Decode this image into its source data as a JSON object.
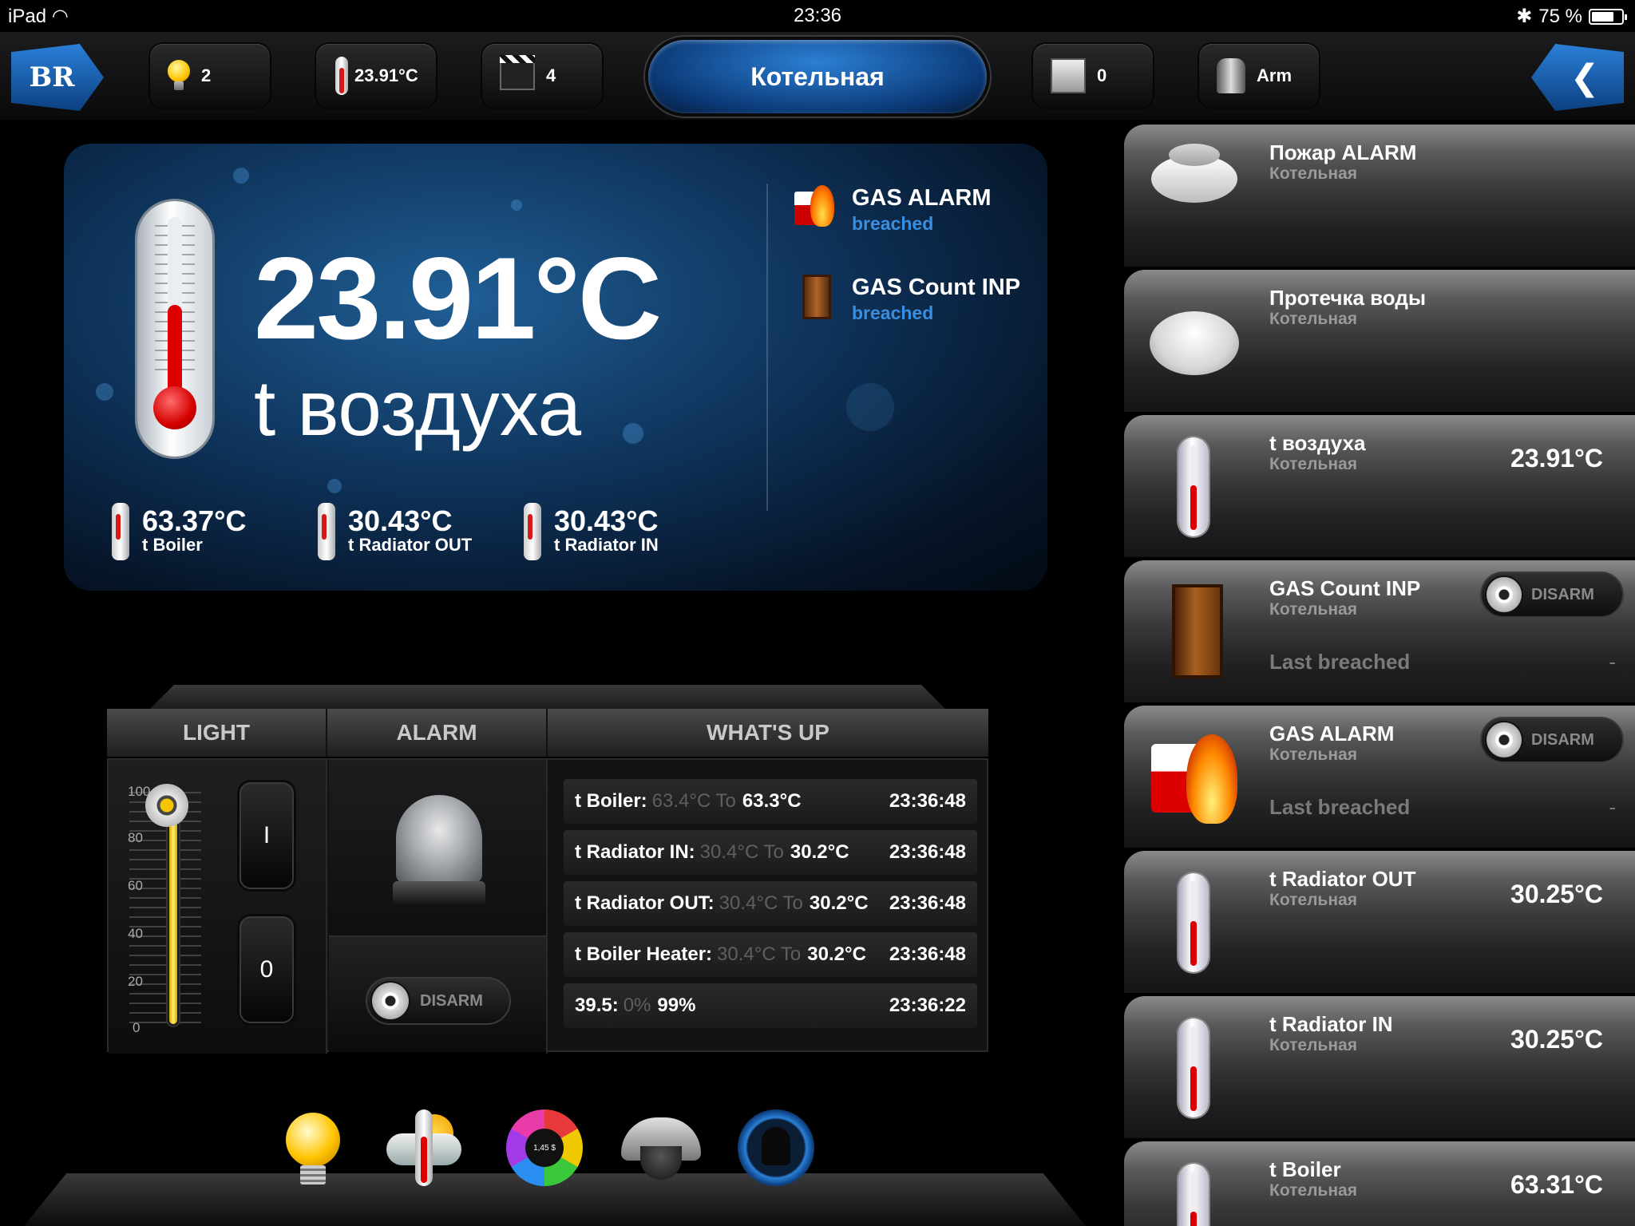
{
  "status_bar": {
    "device": "iPad",
    "time": "23:36",
    "battery": "75 %",
    "battery_level": 0.75
  },
  "toolbar": {
    "home_logo": "BR",
    "lights_count": "2",
    "temperature": "23.91°C",
    "scenes_count": "4",
    "room_title": "Котельная",
    "shades_count": "0",
    "arm_label": "Arm",
    "back_icon": "chevron-left-icon"
  },
  "hero": {
    "temperature": "23.91°C",
    "label": "t воздуха",
    "alerts": [
      {
        "title": "GAS ALARM",
        "status": "breached",
        "icon": "fire-alarm-icon"
      },
      {
        "title": "GAS Count INP",
        "status": "breached",
        "icon": "door-icon"
      }
    ],
    "sensors": [
      {
        "value": "63.37°C",
        "label": "t Boiler"
      },
      {
        "value": "30.43°C",
        "label": "t Radiator OUT"
      },
      {
        "value": "30.43°C",
        "label": "t Radiator IN"
      }
    ]
  },
  "console": {
    "headers": {
      "light": "LIGHT",
      "alarm": "ALARM",
      "whats_up": "WHAT'S UP"
    },
    "light": {
      "scale": [
        "100",
        "80",
        "60",
        "40",
        "20",
        "0"
      ],
      "level_percent": 100,
      "on_label": "I",
      "off_label": "0"
    },
    "alarm": {
      "toggle_label": "DISARM"
    },
    "events": [
      {
        "name": "t Boiler:",
        "from": "63.4°C To",
        "to": "63.3°C",
        "time": "23:36:48"
      },
      {
        "name": "t Radiator IN:",
        "from": "30.4°C To",
        "to": "30.2°C",
        "time": "23:36:48"
      },
      {
        "name": "t Radiator OUT:",
        "from": "30.4°C To",
        "to": "30.2°C",
        "time": "23:36:48"
      },
      {
        "name": "t Boiler Heater:",
        "from": "30.4°C To",
        "to": "30.2°C",
        "time": "23:36:48"
      },
      {
        "name": "39.5:",
        "from": "0%",
        "to": "99%",
        "time": "23:36:22"
      }
    ]
  },
  "dock": {
    "items": [
      "lighting-icon",
      "climate-icon",
      "energy-icon",
      "camera-icon",
      "security-icon"
    ],
    "energy_value": "1,45 $"
  },
  "devices": [
    {
      "name": "Пожар ALARM",
      "room": "Котельная",
      "icon": "smoke-detector-icon"
    },
    {
      "name": "Протечка воды",
      "room": "Котельная",
      "icon": "water-leak-sensor-icon"
    },
    {
      "name": "t воздуха",
      "room": "Котельная",
      "value": "23.91°C",
      "icon": "thermometer-icon"
    },
    {
      "name": "GAS Count INP",
      "room": "Котельная",
      "toggle": "DISARM",
      "last_breached_label": "Last breached",
      "last_breached": "-",
      "icon": "door-icon"
    },
    {
      "name": "GAS ALARM",
      "room": "Котельная",
      "toggle": "DISARM",
      "last_breached_label": "Last breached",
      "last_breached": "-",
      "icon": "fire-alarm-icon"
    },
    {
      "name": "t Radiator OUT",
      "room": "Котельная",
      "value": "30.25°C",
      "icon": "thermometer-icon"
    },
    {
      "name": "t Radiator IN",
      "room": "Котельная",
      "value": "30.25°C",
      "icon": "thermometer-icon"
    },
    {
      "name": "t Boiler",
      "room": "Котельная",
      "value": "63.31°C",
      "icon": "thermometer-icon"
    }
  ]
}
